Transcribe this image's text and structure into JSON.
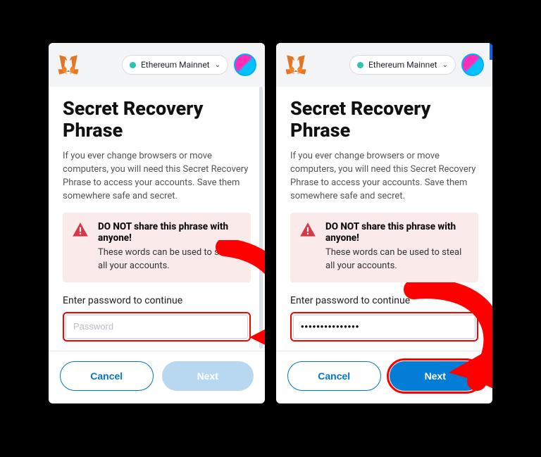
{
  "header": {
    "network_label": "Ethereum Mainnet"
  },
  "page": {
    "title": "Secret Recovery Phrase",
    "description": "If you ever change browsers or move computers, you will need this Secret Recovery Phrase to access your accounts. Save them somewhere safe and secret.",
    "warning_title": "DO NOT share this phrase with anyone!",
    "warning_body": "These words can be used to steal all your accounts.",
    "password_label": "Enter password to continue",
    "password_placeholder": "Password",
    "password_filled_value": "•••••••••••••••",
    "cancel_label": "Cancel",
    "next_label": "Next"
  }
}
